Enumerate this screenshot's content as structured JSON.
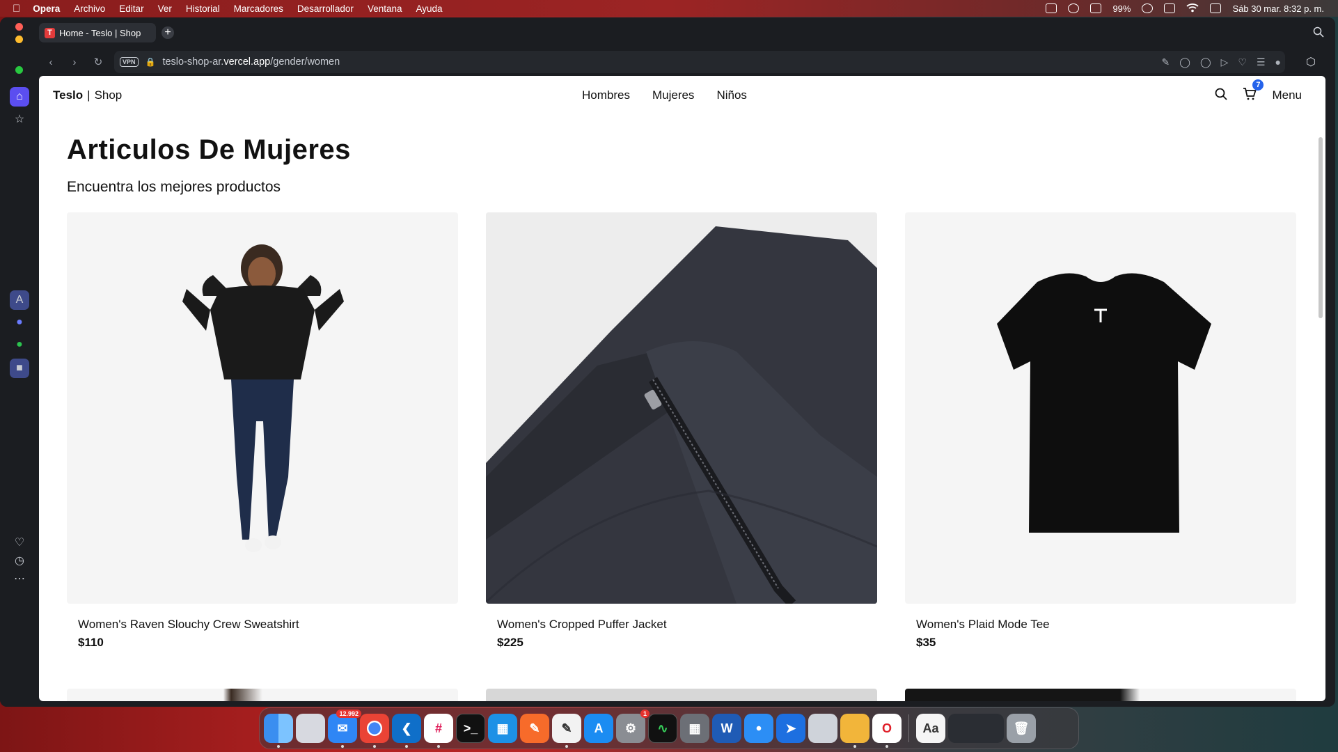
{
  "menubar": {
    "app": "Opera",
    "items": [
      "Archivo",
      "Editar",
      "Ver",
      "Historial",
      "Marcadores",
      "Desarrollador",
      "Ventana",
      "Ayuda"
    ],
    "battery": "99%",
    "clock": "Sáb 30 mar.  8:32 p. m."
  },
  "browser": {
    "tab_title": "Home - Teslo | Shop",
    "new_tab_label": "+",
    "url_prefix": "teslo-shop-ar.",
    "url_domain": "vercel.app",
    "url_path": "/gender/women",
    "vpn_label": "VPN"
  },
  "shop": {
    "logo_brand": "Teslo",
    "logo_separator": "|",
    "logo_suffix": "Shop",
    "nav": [
      "Hombres",
      "Mujeres",
      "Niños"
    ],
    "cart_count": "7",
    "menu_label": "Menu",
    "page_title": "Articulos De Mujeres",
    "page_subtitle": "Encuentra los mejores productos",
    "products": [
      {
        "name": "Women's Raven Slouchy Crew Sweatshirt",
        "price": "$110"
      },
      {
        "name": "Women's Cropped Puffer Jacket",
        "price": "$225"
      },
      {
        "name": "Women's Plaid Mode Tee",
        "price": "$35"
      }
    ]
  },
  "dock": {
    "mail_badge": "12.992",
    "settings_badge": "1"
  }
}
